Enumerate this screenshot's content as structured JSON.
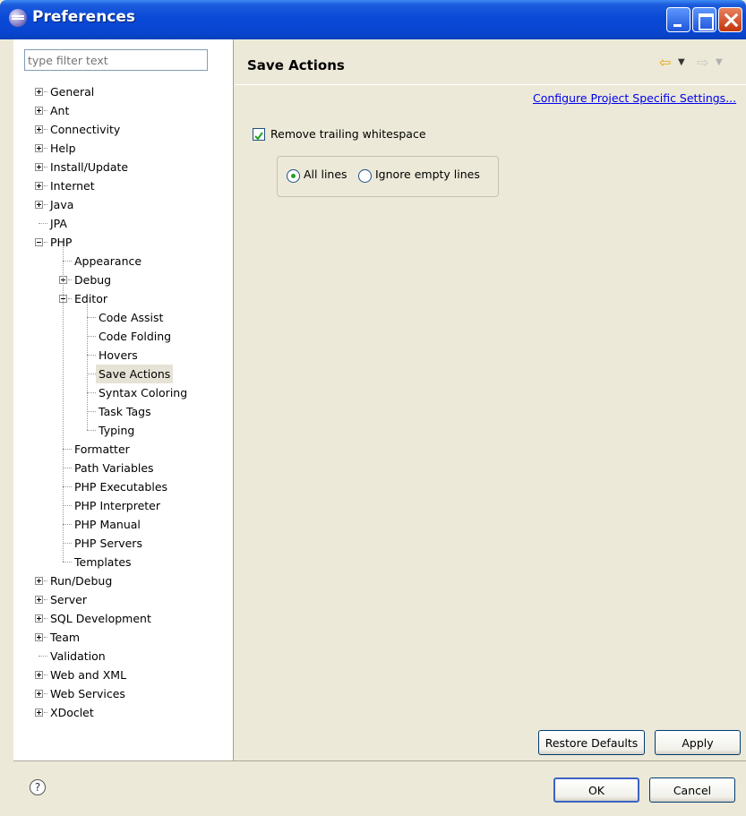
{
  "window": {
    "title": "Preferences"
  },
  "filter": {
    "placeholder": "type filter text"
  },
  "tree": [
    {
      "label": "General",
      "level": 0,
      "toggle": "plus"
    },
    {
      "label": "Ant",
      "level": 0,
      "toggle": "plus"
    },
    {
      "label": "Connectivity",
      "level": 0,
      "toggle": "plus"
    },
    {
      "label": "Help",
      "level": 0,
      "toggle": "plus"
    },
    {
      "label": "Install/Update",
      "level": 0,
      "toggle": "plus"
    },
    {
      "label": "Internet",
      "level": 0,
      "toggle": "plus"
    },
    {
      "label": "Java",
      "level": 0,
      "toggle": "plus"
    },
    {
      "label": "JPA",
      "level": 0,
      "toggle": "none"
    },
    {
      "label": "PHP",
      "level": 0,
      "toggle": "minus"
    },
    {
      "label": "Appearance",
      "level": 1,
      "toggle": "none"
    },
    {
      "label": "Debug",
      "level": 1,
      "toggle": "plus"
    },
    {
      "label": "Editor",
      "level": 1,
      "toggle": "minus"
    },
    {
      "label": "Code Assist",
      "level": 2,
      "toggle": "none"
    },
    {
      "label": "Code Folding",
      "level": 2,
      "toggle": "none"
    },
    {
      "label": "Hovers",
      "level": 2,
      "toggle": "none"
    },
    {
      "label": "Save Actions",
      "level": 2,
      "toggle": "none",
      "selected": true
    },
    {
      "label": "Syntax Coloring",
      "level": 2,
      "toggle": "none"
    },
    {
      "label": "Task Tags",
      "level": 2,
      "toggle": "none"
    },
    {
      "label": "Typing",
      "level": 2,
      "toggle": "none"
    },
    {
      "label": "Formatter",
      "level": 1,
      "toggle": "none"
    },
    {
      "label": "Path Variables",
      "level": 1,
      "toggle": "none"
    },
    {
      "label": "PHP Executables",
      "level": 1,
      "toggle": "none"
    },
    {
      "label": "PHP Interpreter",
      "level": 1,
      "toggle": "none"
    },
    {
      "label": "PHP Manual",
      "level": 1,
      "toggle": "none"
    },
    {
      "label": "PHP Servers",
      "level": 1,
      "toggle": "none"
    },
    {
      "label": "Templates",
      "level": 1,
      "toggle": "none"
    },
    {
      "label": "Run/Debug",
      "level": 0,
      "toggle": "plus"
    },
    {
      "label": "Server",
      "level": 0,
      "toggle": "plus"
    },
    {
      "label": "SQL Development",
      "level": 0,
      "toggle": "plus"
    },
    {
      "label": "Team",
      "level": 0,
      "toggle": "plus"
    },
    {
      "label": "Validation",
      "level": 0,
      "toggle": "none"
    },
    {
      "label": "Web and XML",
      "level": 0,
      "toggle": "plus"
    },
    {
      "label": "Web Services",
      "level": 0,
      "toggle": "plus"
    },
    {
      "label": "XDoclet",
      "level": 0,
      "toggle": "plus"
    }
  ],
  "page": {
    "title": "Save Actions",
    "config_link": "Configure Project Specific Settings...",
    "remove_trailing": {
      "label": "Remove trailing whitespace",
      "checked": true
    },
    "radio_all": {
      "label": "All lines",
      "selected": true
    },
    "radio_ignore": {
      "label": "Ignore empty lines",
      "selected": false
    },
    "restore_defaults": "Restore Defaults",
    "apply": "Apply"
  },
  "footer": {
    "ok": "OK",
    "cancel": "Cancel",
    "help_icon": "help-icon"
  },
  "colors": {
    "titlebar": "#0a4ad8",
    "link": "#0000ee",
    "back_arrow": "#e8a50f"
  }
}
